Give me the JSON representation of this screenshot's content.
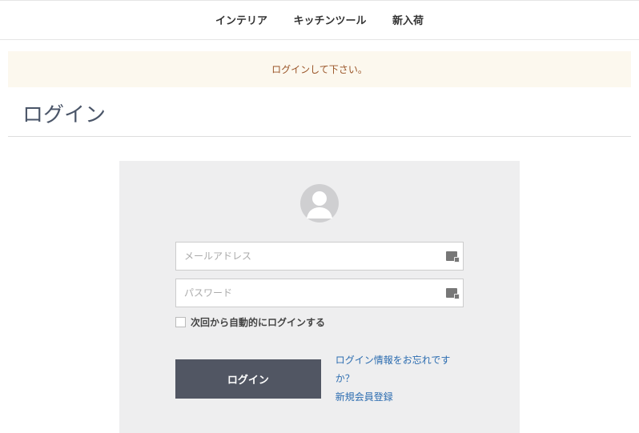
{
  "nav": {
    "items": [
      "インテリア",
      "キッチンツール",
      "新入荷"
    ]
  },
  "alert": {
    "message": "ログインして下さい。"
  },
  "page": {
    "title": "ログイン"
  },
  "login": {
    "email_placeholder": "メールアドレス",
    "email_value": "",
    "password_placeholder": "パスワード",
    "password_value": "",
    "remember_label": "次回から自動的にログインする",
    "submit_label": "ログイン",
    "forgot_label": "ログイン情報をお忘れですか？",
    "register_label": "新規会員登録"
  }
}
